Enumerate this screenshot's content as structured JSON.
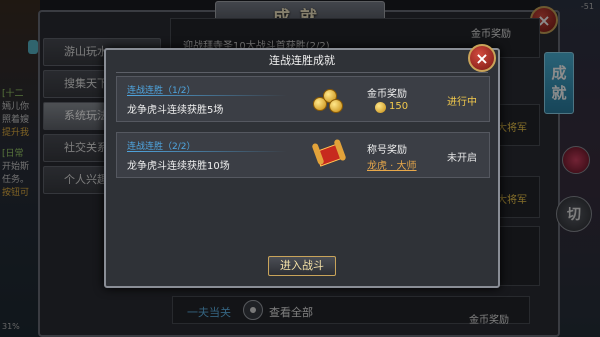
{
  "window": {
    "title": "成就",
    "close_label": "×"
  },
  "left_tabs": [
    {
      "label": "游山玩水"
    },
    {
      "label": "搜集天下"
    },
    {
      "label": "系统玩法"
    },
    {
      "label": "社交关系"
    },
    {
      "label": "个人兴趣"
    }
  ],
  "side_chat": {
    "lines": [
      "[十二",
      "嫣儿你",
      "照着嫂",
      "提升我",
      "[日常",
      "开始斯",
      "任务。",
      "按钮可",
      "31%"
    ]
  },
  "top_right_number": "-51",
  "bg_list": {
    "row1_partial_text": "迎战拜寺圣10大战斗首获胜(2/2)",
    "coin_reward_label": "金币奖励",
    "title_reward_1": "大将军",
    "title_reward_2": "大将军",
    "bottom_reward_label": "金币奖励"
  },
  "side_tab_label": [
    "成",
    "就"
  ],
  "qie_label": "切",
  "bottom_strip": {
    "title": "一夫当关",
    "view_all": "查看全部"
  },
  "popup": {
    "title": "连战连胜成就",
    "close_label": "×",
    "rows": [
      {
        "name": "连战连胜（1/2）",
        "desc": "龙争虎斗连续获胜5场",
        "reward_label": "金币奖励",
        "reward_value": "150",
        "status": "进行中",
        "status_color": "#f2c94c"
      },
      {
        "name": "连战连胜（2/2）",
        "desc": "龙争虎斗连续获胜10场",
        "reward_label": "称号奖励",
        "reward_value": "龙虎 · 大师",
        "status": "未开启",
        "status_color": "#e6e6e6"
      }
    ],
    "enter_button": "进入战斗"
  },
  "colors": {
    "accent_blue": "#4fa6e0",
    "gold": "#f2c94c",
    "title_orange": "#e8a84a"
  }
}
